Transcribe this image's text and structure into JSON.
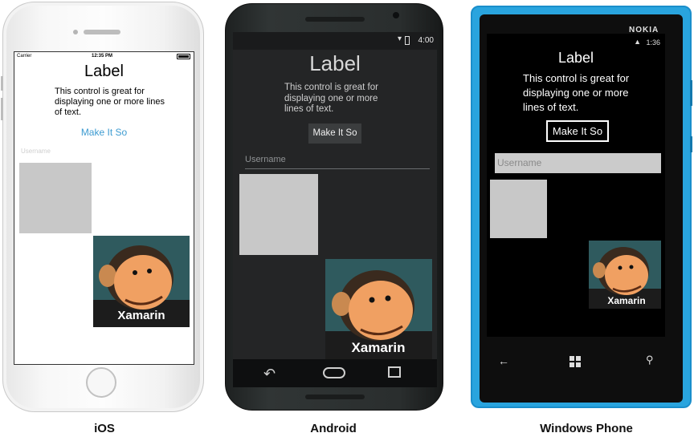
{
  "ios": {
    "status": {
      "carrier": "Carrier",
      "time": "12:35 PM"
    },
    "label": "Label",
    "text": "This control is great for displaying one or more lines of text.",
    "button": "Make It So",
    "username_placeholder": "Username",
    "image_caption": "Xamarin",
    "caption": "iOS"
  },
  "android": {
    "status": {
      "time": "4:00"
    },
    "label": "Label",
    "text": "This control is great for displaying one or more lines of text.",
    "button": "Make It So",
    "username_placeholder": "Username",
    "image_caption": "Xamarin",
    "caption": "Android"
  },
  "windows_phone": {
    "brand": "NOKIA",
    "status": {
      "time": "1:36"
    },
    "label": "Label",
    "text": "This control is great for displaying one or more lines of text.",
    "button": "Make It So",
    "username_placeholder": "Username",
    "image_caption": "Xamarin",
    "caption": "Windows Phone"
  },
  "colors": {
    "ios_button": "#3d9bd1",
    "wp_frame": "#29a4de",
    "box_gray": "#c8c8c8"
  }
}
